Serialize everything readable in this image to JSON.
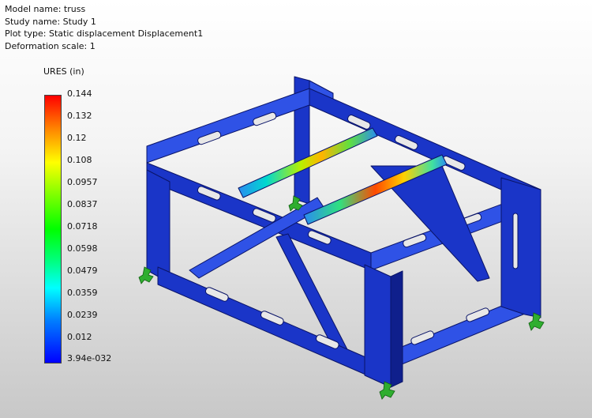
{
  "info": {
    "model_name": "Model name: truss",
    "study_name": "Study name: Study 1",
    "plot_type": "Plot type: Static displacement Displacement1",
    "deformation_scale": "Deformation scale: 1"
  },
  "legend": {
    "units": "URES (in)",
    "ticks": [
      "0.144",
      "0.132",
      "0.12",
      "0.108",
      "0.0957",
      "0.0837",
      "0.0718",
      "0.0598",
      "0.0479",
      "0.0359",
      "0.0239",
      "0.012",
      "3.94e-032"
    ]
  },
  "colors": {
    "structure": "#1a35c8",
    "structure_dark": "#0f1f8c",
    "structure_light": "#2f52e6",
    "fixture": "#2fae2f"
  }
}
